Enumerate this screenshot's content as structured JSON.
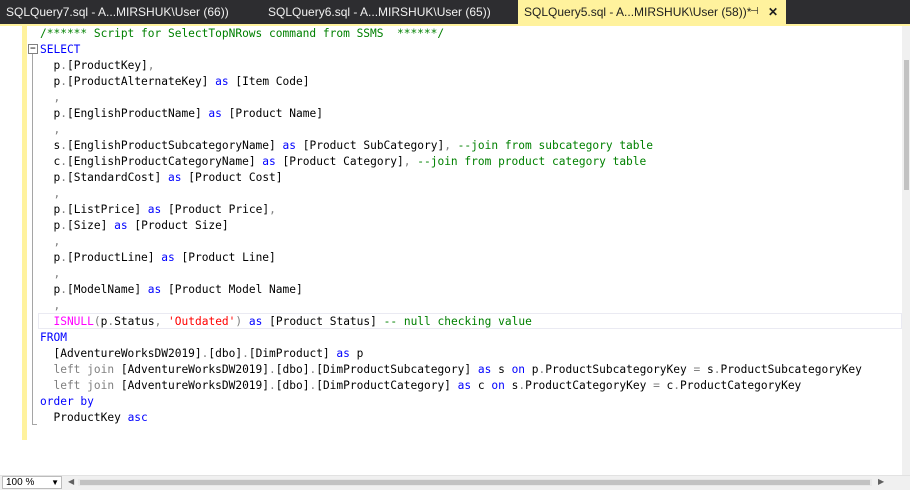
{
  "tabs": [
    {
      "label": "SQLQuery7.sql - A...MIRSHUK\\User (66))",
      "active": false
    },
    {
      "label": "SQLQuery6.sql - A...MIRSHUK\\User (65))",
      "active": false
    },
    {
      "label": "SQLQuery5.sql - A...MIRSHUK\\User (58))*",
      "active": true
    }
  ],
  "tab_icons": {
    "pin": "pin-icon",
    "close": "close-icon"
  },
  "editor": {
    "collapse_glyph": "−",
    "lines": [
      [
        {
          "t": "cm",
          "v": "/****** Script for SelectTopNRows command from SSMS  ******/"
        }
      ],
      [
        {
          "t": "kw",
          "v": "SELECT"
        }
      ],
      [
        {
          "t": "tx",
          "v": "  p"
        },
        {
          "t": "op",
          "v": "."
        },
        {
          "t": "tx",
          "v": "[ProductKey]"
        },
        {
          "t": "op",
          "v": ","
        }
      ],
      [
        {
          "t": "tx",
          "v": "  p"
        },
        {
          "t": "op",
          "v": "."
        },
        {
          "t": "tx",
          "v": "[ProductAlternateKey] "
        },
        {
          "t": "kw",
          "v": "as"
        },
        {
          "t": "tx",
          "v": " [Item Code]"
        }
      ],
      [
        {
          "t": "op",
          "v": "  ,"
        }
      ],
      [
        {
          "t": "tx",
          "v": "  p"
        },
        {
          "t": "op",
          "v": "."
        },
        {
          "t": "tx",
          "v": "[EnglishProductName] "
        },
        {
          "t": "kw",
          "v": "as"
        },
        {
          "t": "tx",
          "v": " [Product Name]"
        }
      ],
      [
        {
          "t": "op",
          "v": "  ,"
        }
      ],
      [
        {
          "t": "tx",
          "v": "  s"
        },
        {
          "t": "op",
          "v": "."
        },
        {
          "t": "tx",
          "v": "[EnglishProductSubcategoryName] "
        },
        {
          "t": "kw",
          "v": "as"
        },
        {
          "t": "tx",
          "v": " [Product SubCategory]"
        },
        {
          "t": "op",
          "v": ", "
        },
        {
          "t": "cm",
          "v": "--join from subcategory table"
        }
      ],
      [
        {
          "t": "tx",
          "v": "  c"
        },
        {
          "t": "op",
          "v": "."
        },
        {
          "t": "tx",
          "v": "[EnglishProductCategoryName] "
        },
        {
          "t": "kw",
          "v": "as"
        },
        {
          "t": "tx",
          "v": " [Product Category]"
        },
        {
          "t": "op",
          "v": ", "
        },
        {
          "t": "cm",
          "v": "--join from product category table"
        }
      ],
      [
        {
          "t": "tx",
          "v": "  p"
        },
        {
          "t": "op",
          "v": "."
        },
        {
          "t": "tx",
          "v": "[StandardCost] "
        },
        {
          "t": "kw",
          "v": "as"
        },
        {
          "t": "tx",
          "v": " [Product Cost]"
        }
      ],
      [
        {
          "t": "op",
          "v": "  ,"
        }
      ],
      [
        {
          "t": "tx",
          "v": "  p"
        },
        {
          "t": "op",
          "v": "."
        },
        {
          "t": "tx",
          "v": "[ListPrice] "
        },
        {
          "t": "kw",
          "v": "as"
        },
        {
          "t": "tx",
          "v": " [Product Price]"
        },
        {
          "t": "op",
          "v": ","
        }
      ],
      [
        {
          "t": "tx",
          "v": "  p"
        },
        {
          "t": "op",
          "v": "."
        },
        {
          "t": "tx",
          "v": "[Size] "
        },
        {
          "t": "kw",
          "v": "as"
        },
        {
          "t": "tx",
          "v": " [Product Size]"
        }
      ],
      [
        {
          "t": "op",
          "v": "  ,"
        }
      ],
      [
        {
          "t": "tx",
          "v": "  p"
        },
        {
          "t": "op",
          "v": "."
        },
        {
          "t": "tx",
          "v": "[ProductLine] "
        },
        {
          "t": "kw",
          "v": "as"
        },
        {
          "t": "tx",
          "v": " [Product Line]"
        }
      ],
      [
        {
          "t": "op",
          "v": "  ,"
        }
      ],
      [
        {
          "t": "tx",
          "v": "  p"
        },
        {
          "t": "op",
          "v": "."
        },
        {
          "t": "tx",
          "v": "[ModelName] "
        },
        {
          "t": "kw",
          "v": "as"
        },
        {
          "t": "tx",
          "v": " [Product Model Name]"
        }
      ],
      [
        {
          "t": "op",
          "v": "  ,"
        }
      ],
      [
        {
          "t": "fn",
          "v": "  ISNULL"
        },
        {
          "t": "op",
          "v": "("
        },
        {
          "t": "tx",
          "v": "p"
        },
        {
          "t": "op",
          "v": "."
        },
        {
          "t": "tx",
          "v": "Status"
        },
        {
          "t": "op",
          "v": ", "
        },
        {
          "t": "str",
          "v": "'Outdated'"
        },
        {
          "t": "op",
          "v": ") "
        },
        {
          "t": "kw",
          "v": "as"
        },
        {
          "t": "tx",
          "v": " [Product Status] "
        },
        {
          "t": "cm",
          "v": "-- null checking value"
        }
      ],
      [
        {
          "t": "kw",
          "v": "FROM"
        }
      ],
      [
        {
          "t": "tx",
          "v": "  [AdventureWorksDW2019]"
        },
        {
          "t": "op",
          "v": "."
        },
        {
          "t": "tx",
          "v": "[dbo]"
        },
        {
          "t": "op",
          "v": "."
        },
        {
          "t": "tx",
          "v": "[DimProduct] "
        },
        {
          "t": "kw",
          "v": "as"
        },
        {
          "t": "tx",
          "v": " p"
        }
      ],
      [
        {
          "t": "op",
          "v": "  left join "
        },
        {
          "t": "tx",
          "v": "[AdventureWorksDW2019]"
        },
        {
          "t": "op",
          "v": "."
        },
        {
          "t": "tx",
          "v": "[dbo]"
        },
        {
          "t": "op",
          "v": "."
        },
        {
          "t": "tx",
          "v": "[DimProductSubcategory] "
        },
        {
          "t": "kw",
          "v": "as"
        },
        {
          "t": "tx",
          "v": " s "
        },
        {
          "t": "kw",
          "v": "on"
        },
        {
          "t": "tx",
          "v": " p"
        },
        {
          "t": "op",
          "v": "."
        },
        {
          "t": "tx",
          "v": "ProductSubcategoryKey "
        },
        {
          "t": "op",
          "v": "="
        },
        {
          "t": "tx",
          "v": " s"
        },
        {
          "t": "op",
          "v": "."
        },
        {
          "t": "tx",
          "v": "ProductSubcategoryKey"
        }
      ],
      [
        {
          "t": "op",
          "v": "  left join "
        },
        {
          "t": "tx",
          "v": "[AdventureWorksDW2019]"
        },
        {
          "t": "op",
          "v": "."
        },
        {
          "t": "tx",
          "v": "[dbo]"
        },
        {
          "t": "op",
          "v": "."
        },
        {
          "t": "tx",
          "v": "[DimProductCategory] "
        },
        {
          "t": "kw",
          "v": "as"
        },
        {
          "t": "tx",
          "v": " c "
        },
        {
          "t": "kw",
          "v": "on"
        },
        {
          "t": "tx",
          "v": " s"
        },
        {
          "t": "op",
          "v": "."
        },
        {
          "t": "tx",
          "v": "ProductCategoryKey "
        },
        {
          "t": "op",
          "v": "="
        },
        {
          "t": "tx",
          "v": " c"
        },
        {
          "t": "op",
          "v": "."
        },
        {
          "t": "tx",
          "v": "ProductCategoryKey"
        }
      ],
      [
        {
          "t": "kw",
          "v": "order by"
        }
      ],
      [
        {
          "t": "tx",
          "v": "  ProductKey "
        },
        {
          "t": "kw",
          "v": "asc"
        }
      ]
    ]
  },
  "statusbar": {
    "zoom": "100 %"
  }
}
